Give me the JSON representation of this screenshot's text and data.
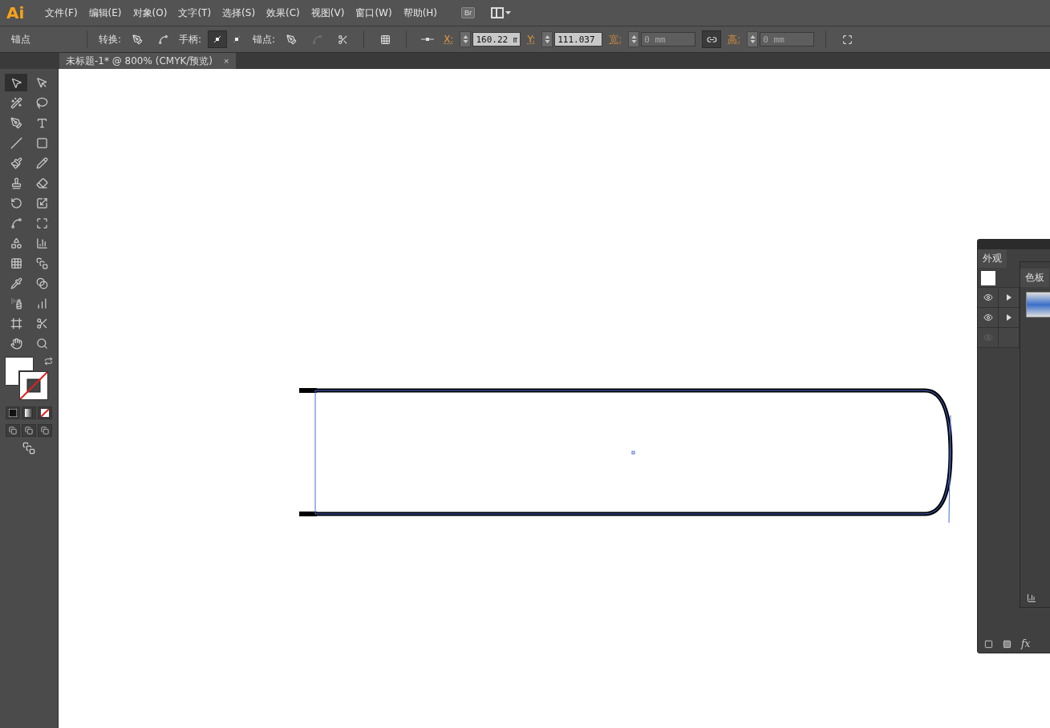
{
  "app": {
    "logo": "Ai",
    "bridge_button": "Br"
  },
  "menu": [
    "文件(F)",
    "编辑(E)",
    "对象(O)",
    "文字(T)",
    "选择(S)",
    "效果(C)",
    "视图(V)",
    "窗口(W)",
    "帮助(H)"
  ],
  "control_bar": {
    "selection_label": "锚点",
    "convert_label": "转换:",
    "handles_label": "手柄:",
    "handle_modes": [
      {
        "selected": true
      },
      {
        "selected": false
      }
    ],
    "anchors_label": "锚点:",
    "x": {
      "label": "X:",
      "value": "160.22 m"
    },
    "y": {
      "label": "Y:",
      "value": "111.037 "
    },
    "width": {
      "label": "宽:",
      "value": "0 mm",
      "disabled": true
    },
    "link_on": true,
    "height": {
      "label": "高:",
      "value": "0 mm",
      "disabled": true
    }
  },
  "document_tab": {
    "title": "未标题-1* @ 800% (CMYK/预览)",
    "close": "×"
  },
  "tools": [
    {
      "selected": true
    },
    {
      "selected": false
    },
    {
      "selected": false
    },
    {
      "selected": false
    },
    {
      "selected": false
    },
    {
      "selected": false
    },
    {
      "selected": false
    },
    {
      "selected": false
    },
    {
      "selected": false
    },
    {
      "selected": false
    },
    {
      "selected": false
    },
    {
      "selected": false
    },
    {
      "selected": false
    },
    {
      "selected": false
    },
    {
      "selected": false
    },
    {
      "selected": false
    },
    {
      "selected": false
    },
    {
      "selected": false
    },
    {
      "selected": false
    },
    {
      "selected": false
    },
    {
      "selected": false
    },
    {
      "selected": false
    },
    {
      "selected": false
    },
    {
      "selected": false
    },
    {
      "selected": false
    },
    {
      "selected": false
    },
    {
      "selected": false
    },
    {
      "selected": false
    }
  ],
  "appearance_panel": {
    "tab": "外观",
    "effects_button": "fx",
    "rows": [
      {
        "visible": true,
        "expandable": true
      },
      {
        "visible": true,
        "expandable": true
      },
      {
        "visible": false,
        "expandable": false
      }
    ]
  },
  "swatches_panel": {
    "tab": "色板"
  }
}
